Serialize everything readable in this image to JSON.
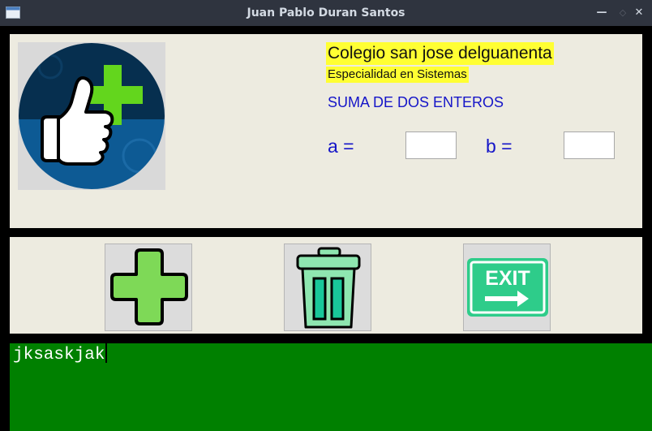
{
  "window": {
    "title": "Juan Pablo Duran Santos",
    "minimize_glyph": "—",
    "maximize_glyph": "◇",
    "close_glyph": "✕"
  },
  "header": {
    "school": "Colegio san jose delguanenta",
    "specialty": "Especialidad en Sistemas",
    "operation_title": "SUMA DE DOS ENTEROS"
  },
  "inputs": {
    "a_label": "a =",
    "a_value": "",
    "b_label": "b =",
    "b_value": ""
  },
  "buttons": {
    "add_icon": "plus-icon",
    "clear_icon": "trash-icon",
    "exit_icon": "exit-sign-icon",
    "exit_sign_text": "EXIT"
  },
  "output": {
    "text": "jksaskjak"
  },
  "colors": {
    "titlebar": "#2f343f",
    "panel_bg": "#edebe0",
    "label_blue": "#1515c8",
    "highlight_yellow": "#ffff33",
    "output_green": "#008000",
    "plus_green": "#7ed957",
    "trash_mint": "#8ee6b0",
    "exit_green": "#2ecc8a"
  }
}
